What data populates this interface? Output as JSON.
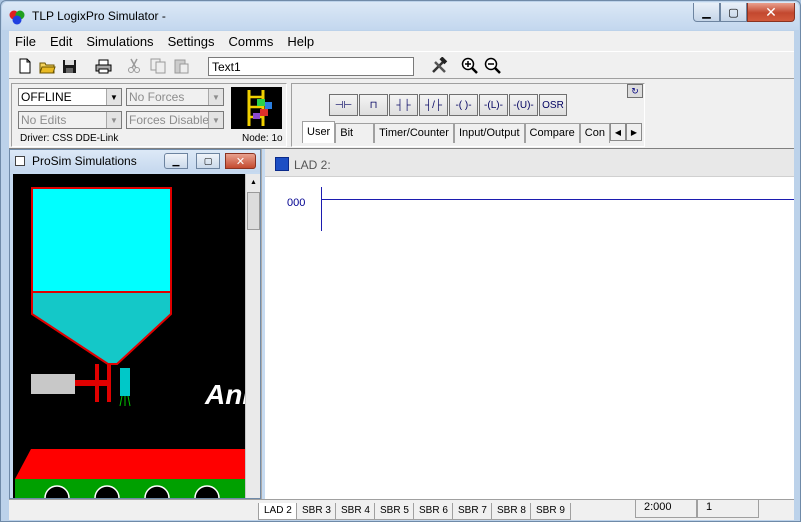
{
  "window": {
    "title": "TLP LogixPro Simulator  -",
    "min_glyph": "▁",
    "max_glyph": "▢",
    "close_glyph": "✕"
  },
  "menu": [
    "File",
    "Edit",
    "Simulations",
    "Settings",
    "Comms",
    "Help"
  ],
  "toolbar": {
    "name_value": "Text1",
    "icons": [
      "new-file-icon",
      "open-folder-icon",
      "save-icon",
      "print-icon",
      "cut-icon",
      "copy-icon",
      "paste-icon",
      "tools-icon",
      "zoom-in-icon",
      "zoom-out-icon"
    ]
  },
  "status": {
    "mode": "OFFLINE",
    "forces": "No Forces",
    "edits": "No Edits",
    "forces_state": "Forces Disabled",
    "driver": "Driver: CSS DDE-Link",
    "node": "Node: 1o"
  },
  "instructions": {
    "buttons": [
      {
        "name": "xic-rung-button",
        "glyph": "⊣⊢"
      },
      {
        "name": "branch-button",
        "glyph": "⊓"
      },
      {
        "name": "xic-button",
        "glyph": "┤├"
      },
      {
        "name": "xio-button",
        "glyph": "┤/├"
      },
      {
        "name": "ote-button",
        "glyph": "-( )-"
      },
      {
        "name": "otl-button",
        "glyph": "-(L)-"
      },
      {
        "name": "otu-button",
        "glyph": "-(U)-"
      },
      {
        "name": "osr-button",
        "glyph": "OSR"
      }
    ],
    "tabs": [
      "User",
      "Bit",
      "Timer/Counter",
      "Input/Output",
      "Compare",
      "Con"
    ],
    "active_tab": "User",
    "refresh_glyph": "↻"
  },
  "prosim": {
    "title": "ProSim Simulations",
    "overlay_text": "Ani"
  },
  "ladder": {
    "title": "LAD 2:",
    "rung_number": "000"
  },
  "bottom": {
    "sub_tabs": [
      "LAD 2",
      "SBR 3",
      "SBR 4",
      "SBR 5",
      "SBR 6",
      "SBR 7",
      "SBR 8",
      "SBR 9"
    ],
    "active_sub": "LAD 2",
    "address": "2:000",
    "rung_count": "1"
  },
  "colors": {
    "hopper": "#00ffff",
    "hopper_outline": "#e00000",
    "conveyor": "#ff0000",
    "rung_wire": "#1c1cb0"
  }
}
